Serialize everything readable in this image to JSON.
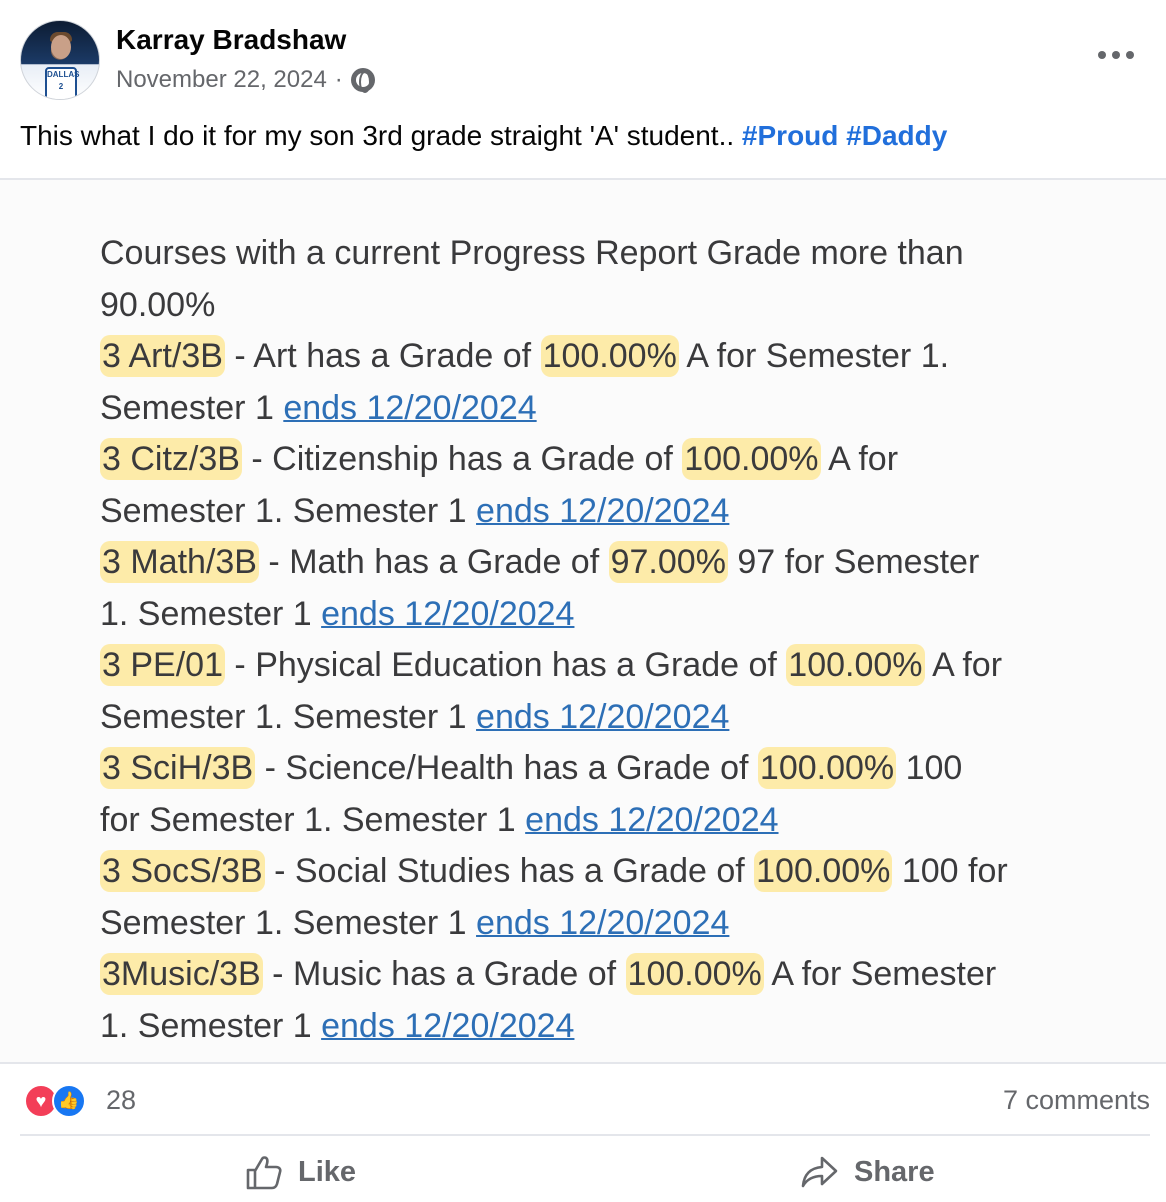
{
  "post": {
    "author": "Karray Bradshaw",
    "date": "November 22, 2024",
    "separator": "·",
    "visibility_icon": "globe-icon",
    "avatar_jersey_text": "DALLAS 2",
    "caption": {
      "text": "This what I do it for my son 3rd grade straight 'A' student.. ",
      "hashtags": [
        "#Proud",
        "#Daddy"
      ]
    }
  },
  "report": {
    "intro_line1": "Courses with a current Progress Report Grade more than",
    "intro_line2": "90.00%",
    "courses": [
      {
        "code": "3 Art/3B",
        "line1_mid": " - Art has a Grade of ",
        "grade": "100.00%",
        "line1_tail": " A for Semester 1.",
        "line2_lead": "Semester 1 ",
        "link": "ends 12/20/2024"
      },
      {
        "code": "3 Citz/3B",
        "line1_mid": " - Citizenship has a Grade of ",
        "grade": "100.00%",
        "line1_tail": " A for",
        "line2_lead": "Semester 1.  Semester 1 ",
        "link": "ends 12/20/2024"
      },
      {
        "code": "3 Math/3B",
        "line1_mid": " - Math has a Grade of ",
        "grade": "97.00%",
        "line1_tail": " 97 for Semester",
        "line2_lead": "1.  Semester 1 ",
        "link": "ends 12/20/2024"
      },
      {
        "code": "3 PE/01",
        "line1_mid": " - Physical Education has a Grade of ",
        "grade": "100.00%",
        "line1_tail": " A for",
        "line2_lead": "Semester 1.  Semester 1 ",
        "link": "ends 12/20/2024"
      },
      {
        "code": "3 SciH/3B",
        "line1_mid": " - Science/Health has a Grade of ",
        "grade": "100.00%",
        "line1_tail": " 100",
        "line2_lead": "for Semester 1.  Semester 1 ",
        "link": "ends 12/20/2024"
      },
      {
        "code": "3 SocS/3B",
        "line1_mid": " - Social Studies has a Grade of ",
        "grade": "100.00%",
        "line1_tail": " 100 for",
        "line2_lead": "Semester 1.  Semester 1 ",
        "link": "ends 12/20/2024"
      },
      {
        "code": "3Music/3B",
        "line1_mid": " - Music has a Grade of ",
        "grade": "100.00%",
        "line1_tail": " A for Semester",
        "line2_lead": "1.  Semester 1 ",
        "link": "ends 12/20/2024"
      }
    ],
    "highlight_color": "#ffde66",
    "link_color": "#2d6fb6"
  },
  "stats": {
    "reaction_icons": [
      "heart-reaction-icon",
      "like-reaction-icon"
    ],
    "reaction_count": "28",
    "comments": "7 comments"
  },
  "actions": {
    "like_label": "Like",
    "share_label": "Share"
  },
  "colors": {
    "hashtag": "#216fdb",
    "secondary_text": "#65676b",
    "like_blue": "#1877f2",
    "heart_red": "#f33e58"
  }
}
